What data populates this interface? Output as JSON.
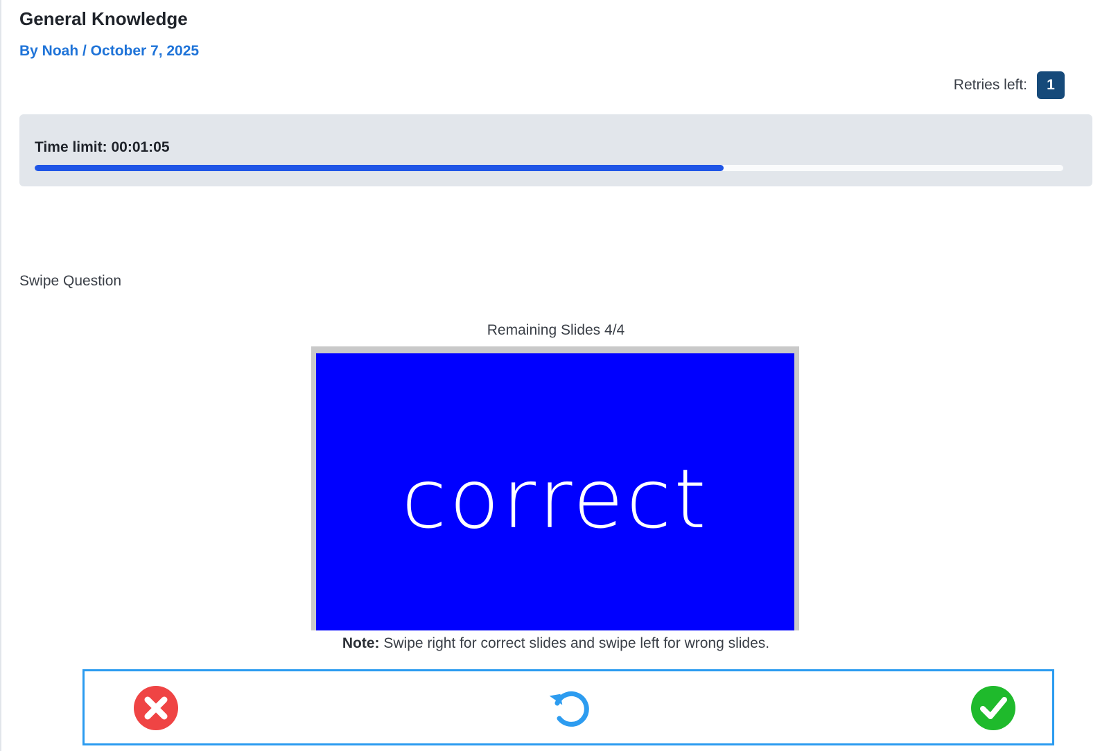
{
  "header": {
    "title": "General Knowledge",
    "byline": "By Noah / October 7, 2025"
  },
  "retries": {
    "label": "Retries left:",
    "count": "1"
  },
  "timer": {
    "label": "Time limit: 00:01:05",
    "progress_fraction": 0.67,
    "bar_color": "#1f55e6"
  },
  "question": {
    "type_label": "Swipe Question",
    "remaining": "Remaining Slides 4/4",
    "slide_text": "correct",
    "slide_color": "#0000ff",
    "note_prefix": "Note:",
    "note_text": " Swipe right for correct slides and swipe left for wrong slides."
  },
  "controls": {
    "wrong_icon": "x-circle-icon",
    "reset_icon": "undo-icon",
    "right_icon": "check-circle-icon",
    "wrong_color": "#ef4444",
    "reset_color": "#2d9cf0",
    "right_color": "#1fba2c"
  }
}
